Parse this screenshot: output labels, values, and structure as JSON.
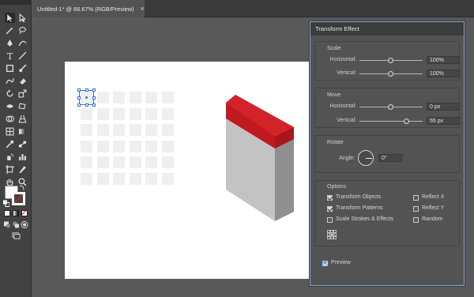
{
  "document_tab": {
    "title": "Untitled-1* @ 66.67% (RGB/Preview)",
    "close": "×"
  },
  "panel": {
    "title": "Transform Effect",
    "scale": {
      "label": "Scale",
      "horizontal_label": "Horizontal:",
      "horizontal_value": "100%",
      "horizontal_position": 0.5,
      "vertical_label": "Vertical:",
      "vertical_value": "100%",
      "vertical_position": 0.5
    },
    "move": {
      "label": "Move",
      "horizontal_label": "Horizontal:",
      "horizontal_value": "0 px",
      "horizontal_position": 0.5,
      "vertical_label": "Vertical:",
      "vertical_value": "55 px",
      "vertical_position": 0.75
    },
    "rotate": {
      "label": "Rotate",
      "angle_label": "Angle:",
      "angle_value": "0°"
    },
    "options": {
      "label": "Options",
      "transform_objects": {
        "label": "Transform Objects",
        "checked": true
      },
      "transform_patterns": {
        "label": "Transform Patterns",
        "checked": true
      },
      "scale_strokes": {
        "label": "Scale Strokes & Effects",
        "checked": false
      },
      "reflect_x": {
        "label": "Reflect X",
        "checked": false
      },
      "reflect_y": {
        "label": "Reflect Y",
        "checked": false
      },
      "random": {
        "label": "Random",
        "checked": false
      }
    },
    "preview": {
      "label": "Preview",
      "checked": true
    }
  },
  "colors": {
    "selection": "#3d6fd6",
    "extrusion_top": "#d01c24",
    "panel_border": "#7ea8df"
  }
}
